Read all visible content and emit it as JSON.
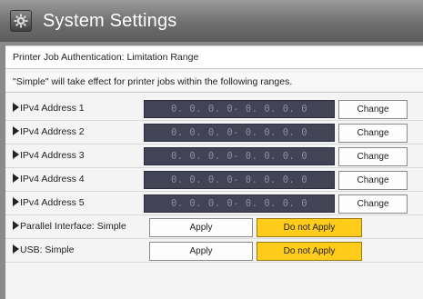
{
  "window": {
    "title": "System Settings",
    "icon": "gear-icon"
  },
  "header": {
    "title": "Printer Job Authentication: Limitation Range",
    "note": "\"Simple\" will take effect for printer jobs within the following ranges."
  },
  "ipv4": [
    {
      "label": "IPv4 Address 1",
      "value": "0. 0. 0. 0- 0. 0. 0. 0",
      "button": "Change"
    },
    {
      "label": "IPv4 Address 2",
      "value": "0. 0. 0. 0- 0. 0. 0. 0",
      "button": "Change"
    },
    {
      "label": "IPv4 Address 3",
      "value": "0. 0. 0. 0- 0. 0. 0. 0",
      "button": "Change"
    },
    {
      "label": "IPv4 Address 4",
      "value": "0. 0. 0. 0- 0. 0. 0. 0",
      "button": "Change"
    },
    {
      "label": "IPv4 Address 5",
      "value": "0. 0. 0. 0- 0. 0. 0. 0",
      "button": "Change"
    }
  ],
  "parallel": {
    "label": "Parallel Interface: Simple",
    "apply": "Apply",
    "no_apply": "Do not Apply",
    "selected": "no_apply"
  },
  "usb": {
    "label": "USB: Simple",
    "apply": "Apply",
    "no_apply": "Do not Apply",
    "selected": "no_apply"
  },
  "colors": {
    "selected": "#ffcc1c",
    "ip_field_bg": "#434356"
  }
}
